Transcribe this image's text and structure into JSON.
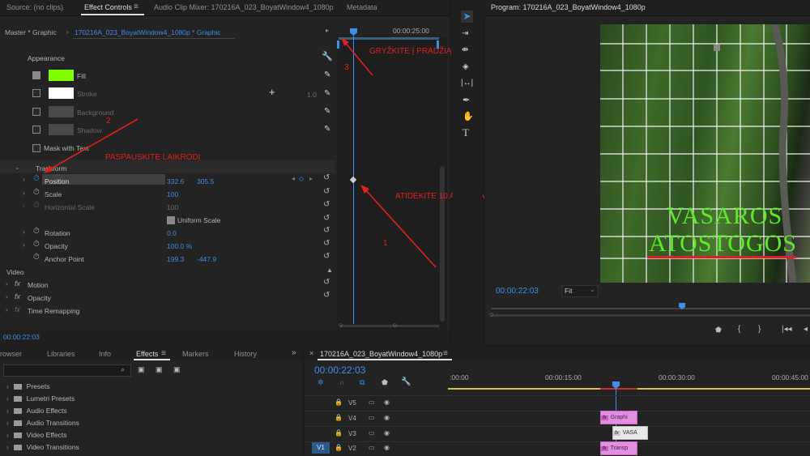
{
  "top_tabs": {
    "source": "Source: (no clips)",
    "effect_controls": "Effect Controls",
    "audio_mixer": "Audio Clip Mixer: 170216A_023_BoyatWindow4_1080p",
    "metadata": "Metadata"
  },
  "effect_controls": {
    "master_label": "Master * Graphic",
    "clip_label": "170216A_023_BoyatWindow4_1080p * Graphic",
    "timeline_time": "00:00:25:00",
    "appearance_label": "Appearance",
    "fill_label": "Fill",
    "stroke_label": "Stroke",
    "stroke_value": "1.0",
    "background_label": "Background",
    "shadow_label": "Shadow",
    "mask_label": "Mask with Text",
    "transform_label": "Transform",
    "position_label": "Position",
    "position_x": "332.6",
    "position_y": "305.5",
    "scale_label": "Scale",
    "scale_value": "100",
    "hscale_label": "Horizontal Scale",
    "hscale_value": "100",
    "uniform_label": "Uniform Scale",
    "rotation_label": "Rotation",
    "rotation_value": "0.0",
    "opacity_label": "Opacity",
    "opacity_value": "100.0 %",
    "anchor_label": "Anchor Point",
    "anchor_x": "199.3",
    "anchor_y": "-447.9",
    "video_label": "Video",
    "motion_label": "Motion",
    "opacity2_label": "Opacity",
    "timeremap_label": "Time Remapping",
    "current_time": "00:00:22:03",
    "fill_color": "#7dff00",
    "stroke_color": "#ffffff"
  },
  "annotations": {
    "a1_text": "GRYŽKITE Į PRADŽIĄ",
    "a1_num": "3",
    "a2_text": "PASPAUSKITE LAIKRODĮ",
    "a2_num": "2",
    "a3_text": "ATIDĖKITE 10 ARBA DAUGIAU KEYFRAMES",
    "a3_num": "1",
    "color": "#e02020"
  },
  "program": {
    "title": "Program: 170216A_023_BoyatWindow4_1080p",
    "title_line1": "VASAROS",
    "title_line2": "ATOSTOGOS",
    "timecode": "00:00:22:03",
    "fit_label": "Fit"
  },
  "effects_panel": {
    "tabs": [
      "rowser",
      "Libraries",
      "Info",
      "Effects",
      "Markers",
      "History"
    ],
    "items": [
      "Presets",
      "Lumetri Presets",
      "Audio Effects",
      "Audio Transitions",
      "Video Effects",
      "Video Transitions"
    ]
  },
  "timeline": {
    "sequence_name": "170216A_023_BoyatWindow4_1080p",
    "timecode": "00:00:22:03",
    "ruler": [
      ":00:00",
      "00:00:15:00",
      "00:00:30:00",
      "00:00:45:00"
    ],
    "tracks": [
      {
        "name": "V5"
      },
      {
        "name": "V4"
      },
      {
        "name": "V3"
      },
      {
        "name": "V2"
      }
    ],
    "source_track": "V1",
    "clips": [
      "Graphi",
      "VASA",
      "Transp"
    ]
  }
}
